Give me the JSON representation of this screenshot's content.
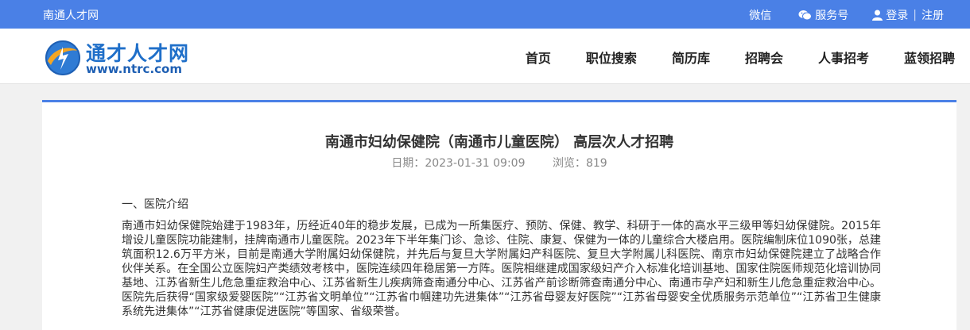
{
  "topbar": {
    "site_name": "南通人才网",
    "wechat_label": "微信",
    "service_label": "服务号",
    "login_label": "登录",
    "separator": "|",
    "register_label": "注册"
  },
  "logo": {
    "cn_text": "通才人才网",
    "en_text": "www.ntrc.com"
  },
  "nav": {
    "items": [
      "首页",
      "职位搜索",
      "简历库",
      "招聘会",
      "人事招考",
      "蓝领招聘"
    ]
  },
  "article": {
    "title": "南通市妇幼保健院（南通市儿童医院） 高层次人才招聘",
    "date_label": "日期：",
    "date": "2023-01-31 09:09",
    "views_label": "浏览：",
    "views": "819",
    "section1": "一、医院介绍",
    "paragraph1": "南通市妇幼保健院始建于1983年，历经近40年的稳步发展，已成为一所集医疗、预防、保健、教学、科研于一体的高水平三级甲等妇幼保健院。2015年增设儿童医院功能建制，挂牌南通市儿童医院。2023年下半年集门诊、急诊、住院、康复、保健为一体的儿童综合大楼启用。医院编制床位1090张，总建筑面积12.6万平方米，目前是南通大学附属妇幼保健院，并先后与复旦大学附属妇产科医院、复旦大学附属儿科医院、南京市妇幼保健院建立了战略合作伙伴关系。在全国公立医院妇产类绩效考核中，医院连续四年稳居第一方阵。医院相继建成国家级妇产介入标准化培训基地、国家住院医师规范化培训协同基地、江苏省新生儿危急重症救治中心、江苏省新生儿疾病筛查南通分中心、江苏省产前诊断筛查南通分中心、南通市孕产妇和新生儿危急重症救治中心。医院先后获得“国家级爱婴医院”“江苏省文明单位”“江苏省巾帼建功先进集体”“江苏省母婴友好医院”“江苏省母婴安全优质服务示范单位”“江苏省卫生健康系统先进集体”“江苏省健康促进医院”等国家、省级荣誉。"
  }
}
